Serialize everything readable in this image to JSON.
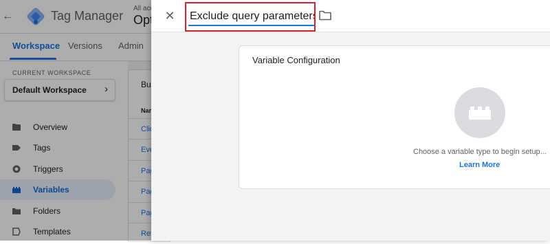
{
  "app": {
    "back_glyph": "←",
    "title": "Tag Manager",
    "account_label": "All acc",
    "container_label": "Opt"
  },
  "nav": {
    "tabs": [
      {
        "label": "Workspace",
        "active": true
      },
      {
        "label": "Versions",
        "active": false
      },
      {
        "label": "Admin",
        "active": false
      }
    ]
  },
  "sidebar": {
    "workspace_caption": "CURRENT WORKSPACE",
    "workspace_name": "Default Workspace",
    "workspace_chevron": "›",
    "items": [
      {
        "label": "Overview",
        "icon": "overview-icon",
        "active": false
      },
      {
        "label": "Tags",
        "icon": "tag-icon",
        "active": false
      },
      {
        "label": "Triggers",
        "icon": "trigger-icon",
        "active": false
      },
      {
        "label": "Variables",
        "icon": "variables-icon",
        "active": true
      },
      {
        "label": "Folders",
        "icon": "folder-icon",
        "active": false
      },
      {
        "label": "Templates",
        "icon": "templates-icon",
        "active": false
      }
    ]
  },
  "variables_list": {
    "card_title": "Bu",
    "column_header": "Nar",
    "rows": [
      "Clic",
      "Eve",
      "Pag",
      "Pag",
      "Pag",
      "Ref"
    ]
  },
  "panel": {
    "close_glyph": "✕",
    "variable_name": "Exclude query parameters",
    "folder_icon": "folder-icon",
    "config": {
      "title": "Variable Configuration",
      "hint": "Choose a variable type to begin setup...",
      "learn_more": "Learn More",
      "placeholder_icon": "blocks-icon"
    }
  },
  "colors": {
    "accent": "#1a73e8",
    "highlight": "#e0202a",
    "panel_bg": "#f1f3f4"
  }
}
